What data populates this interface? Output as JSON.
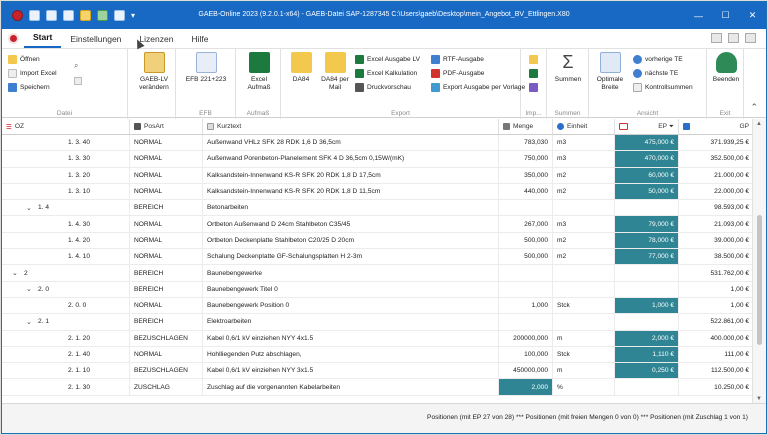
{
  "window": {
    "title": "GAEB-Online 2023 (9.2.0.1-x64) - GAEB-Datei  SAP-1287345 C:\\Users\\gaeb\\Desktop\\mein_Angebot_BV_Ettlingen.X80",
    "minimize": "—",
    "maximize": "☐",
    "close": "✕"
  },
  "menu": {
    "tabs": [
      "Start",
      "Einstellungen",
      "Lizenzen",
      "Hilfe"
    ],
    "active": "Start"
  },
  "ribbon": {
    "datei": {
      "label": "Datei",
      "open": "Öffnen",
      "import_excel": "Import Excel",
      "save": "Speichern",
      "gaeb_lv": "GAEB-LV verändern"
    },
    "efb": {
      "label": "EFB",
      "efb_btn": "EFB 221+223"
    },
    "aufmass": {
      "label": "Aufmaß",
      "excel_aufmass": "Excel Aufmaß"
    },
    "export": {
      "label": "Export",
      "da84": "DA84",
      "da84_mail": "DA84 per Mail",
      "excel_lv": "Excel Ausgabe LV",
      "excel_kalk": "Excel Kalkulation",
      "druck": "Druckvorschau",
      "rtf": "RTF-Ausgabe",
      "pdf": "PDF-Ausgabe",
      "export_vorlage": "Export Ausgabe per Vorlage"
    },
    "import": {
      "label": "Imp..."
    },
    "summen": {
      "label": "Summen",
      "summen_btn": "Summen"
    },
    "ansicht": {
      "label": "Ansicht",
      "opt_breite": "Optimale Breite",
      "vorherige": "vorherige TE",
      "naechste": "nächste TE",
      "kontroll": "Kontrollsummen"
    },
    "exit": {
      "label": "Exit",
      "beenden": "Beenden"
    }
  },
  "grid": {
    "headers": {
      "oz": "OZ",
      "posart": "PosArt",
      "kurztext": "Kurztext",
      "menge": "Menge",
      "einheit": "Einheit",
      "ep": "EP",
      "gp": "GP"
    },
    "rows": [
      {
        "oz": "1.  3.  40",
        "posart": "NORMAL",
        "kurztext": "Außenwand VHLz SFK 28 RDK 1,6 D 36,5cm",
        "menge": "783,030",
        "einheit": "m3",
        "ep": "475,000 €",
        "gp": "371.939,25 €",
        "level": 3,
        "ep_hl": true,
        "menge_hl": false
      },
      {
        "oz": "1.  3.  30",
        "posart": "NORMAL",
        "kurztext": "Außenwand Porenbeton-Planelement SFK 4 D 36,5cm 0,15W/(mK)",
        "menge": "750,000",
        "einheit": "m3",
        "ep": "470,000 €",
        "gp": "352.500,00 €",
        "level": 3,
        "ep_hl": true,
        "menge_hl": false
      },
      {
        "oz": "1.  3.  20",
        "posart": "NORMAL",
        "kurztext": "Kalksandstein-Innenwand KS-R SFK 20 RDK 1,8 D 17,5cm",
        "menge": "350,000",
        "einheit": "m2",
        "ep": "60,000 €",
        "gp": "21.000,00 €",
        "level": 3,
        "ep_hl": true,
        "menge_hl": false
      },
      {
        "oz": "1.  3.  10",
        "posart": "NORMAL",
        "kurztext": "Kalksandstein-Innenwand KS-R SFK 20 RDK 1,8 D 11,5cm",
        "menge": "440,000",
        "einheit": "m2",
        "ep": "50,000 €",
        "gp": "22.000,00 €",
        "level": 3,
        "ep_hl": true,
        "menge_hl": false
      },
      {
        "oz": "1.  4",
        "posart": "BEREICH",
        "kurztext": "Betonarbeiten",
        "menge": "",
        "einheit": "",
        "ep": "",
        "gp": "98.593,00 €",
        "level": 1,
        "ep_hl": false,
        "menge_hl": false
      },
      {
        "oz": "1.  4.  30",
        "posart": "NORMAL",
        "kurztext": "Ortbeton Außenwand D 24cm Stahlbeton C35/45",
        "menge": "267,000",
        "einheit": "m3",
        "ep": "79,000 €",
        "gp": "21.093,00 €",
        "level": 3,
        "ep_hl": true,
        "menge_hl": false
      },
      {
        "oz": "1.  4.  20",
        "posart": "NORMAL",
        "kurztext": "Ortbeton Deckenplatte Stahlbeton C20/25 D 20cm",
        "menge": "500,000",
        "einheit": "m2",
        "ep": "78,000 €",
        "gp": "39.000,00 €",
        "level": 3,
        "ep_hl": true,
        "menge_hl": false
      },
      {
        "oz": "1.  4.  10",
        "posart": "NORMAL",
        "kurztext": "Schalung Deckenplatte GF-Schalungsplatten H 2-3m",
        "menge": "500,000",
        "einheit": "m2",
        "ep": "77,000 €",
        "gp": "38.500,00 €",
        "level": 3,
        "ep_hl": true,
        "menge_hl": false
      },
      {
        "oz": "2",
        "posart": "BEREICH",
        "kurztext": "Baunebengewerke",
        "menge": "",
        "einheit": "",
        "ep": "",
        "gp": "531.762,00 €",
        "level": 0,
        "ep_hl": false,
        "menge_hl": false
      },
      {
        "oz": "2.  0",
        "posart": "BEREICH",
        "kurztext": "Baunebengewerk Titel 0",
        "menge": "",
        "einheit": "",
        "ep": "",
        "gp": "1,00 €",
        "level": 1,
        "ep_hl": false,
        "menge_hl": false
      },
      {
        "oz": "2.  0.  0",
        "posart": "NORMAL",
        "kurztext": "Baunebengewerk Position 0",
        "menge": "1,000",
        "einheit": "Stck",
        "ep": "1,000 €",
        "gp": "1,00 €",
        "level": 3,
        "ep_hl": true,
        "menge_hl": false
      },
      {
        "oz": "2.  1",
        "posart": "BEREICH",
        "kurztext": "Elektroarbeiten",
        "menge": "",
        "einheit": "",
        "ep": "",
        "gp": "522.861,00 €",
        "level": 1,
        "ep_hl": false,
        "menge_hl": false
      },
      {
        "oz": "2.  1.  20",
        "posart": "BEZUSCHLAGEN",
        "kurztext": "Kabel 0,6/1 kV einziehen NYY 4x1.5",
        "menge": "200000,000",
        "einheit": "m",
        "ep": "2,000 €",
        "gp": "400.000,00 €",
        "level": 3,
        "ep_hl": true,
        "menge_hl": false
      },
      {
        "oz": "2.  1.  40",
        "posart": "NORMAL",
        "kurztext": "Hohlliegenden Putz abschlagen,",
        "menge": "100,000",
        "einheit": "Stck",
        "ep": "1,110 €",
        "gp": "111,00 €",
        "level": 3,
        "ep_hl": true,
        "menge_hl": false
      },
      {
        "oz": "2.  1.  10",
        "posart": "BEZUSCHLAGEN",
        "kurztext": "Kabel 0,6/1 kV einziehen NYY 3x1.5",
        "menge": "450000,000",
        "einheit": "m",
        "ep": "0,250 €",
        "gp": "112.500,00 €",
        "level": 3,
        "ep_hl": true,
        "menge_hl": false
      },
      {
        "oz": "2.  1.  30",
        "posart": "ZUSCHLAG",
        "kurztext": "Zuschlag auf die vorgenannten Kabelarbeiten",
        "menge": "2,000",
        "einheit": "%",
        "ep": "",
        "gp": "10.250,00 €",
        "level": 3,
        "ep_hl": false,
        "menge_hl": true
      }
    ]
  },
  "status": {
    "text": "Positionen (mit EP 27 von 28) *** Positionen (mit freien Mengen 0 von 0) *** Positionen (mit Zuschlag 1 von 1)"
  },
  "colors": {
    "titlebar": "#1769c4",
    "highlight": "#2f8594"
  }
}
